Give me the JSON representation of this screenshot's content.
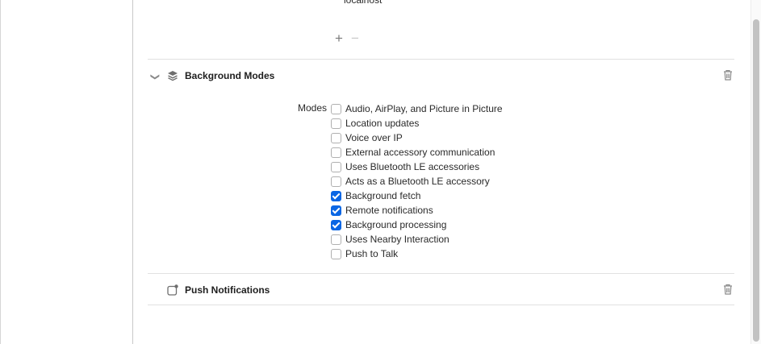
{
  "top_remnant": {
    "host_value": "localhost",
    "add_symbol": "+",
    "remove_symbol": "−"
  },
  "background_modes": {
    "title": "Background Modes",
    "icon": "layers-icon",
    "modes_label": "Modes",
    "modes": [
      {
        "label": "Audio, AirPlay, and Picture in Picture",
        "checked": false
      },
      {
        "label": "Location updates",
        "checked": false
      },
      {
        "label": "Voice over IP",
        "checked": false
      },
      {
        "label": "External accessory communication",
        "checked": false
      },
      {
        "label": "Uses Bluetooth LE accessories",
        "checked": false
      },
      {
        "label": "Acts as a Bluetooth LE accessory",
        "checked": false
      },
      {
        "label": "Background fetch",
        "checked": true
      },
      {
        "label": "Remote notifications",
        "checked": true
      },
      {
        "label": "Background processing",
        "checked": true
      },
      {
        "label": "Uses Nearby Interaction",
        "checked": false
      },
      {
        "label": "Push to Talk",
        "checked": false
      }
    ]
  },
  "push_notifications": {
    "title": "Push Notifications",
    "icon": "notification-badge-icon"
  },
  "colors": {
    "checkbox_accent": "#0a66e4"
  }
}
